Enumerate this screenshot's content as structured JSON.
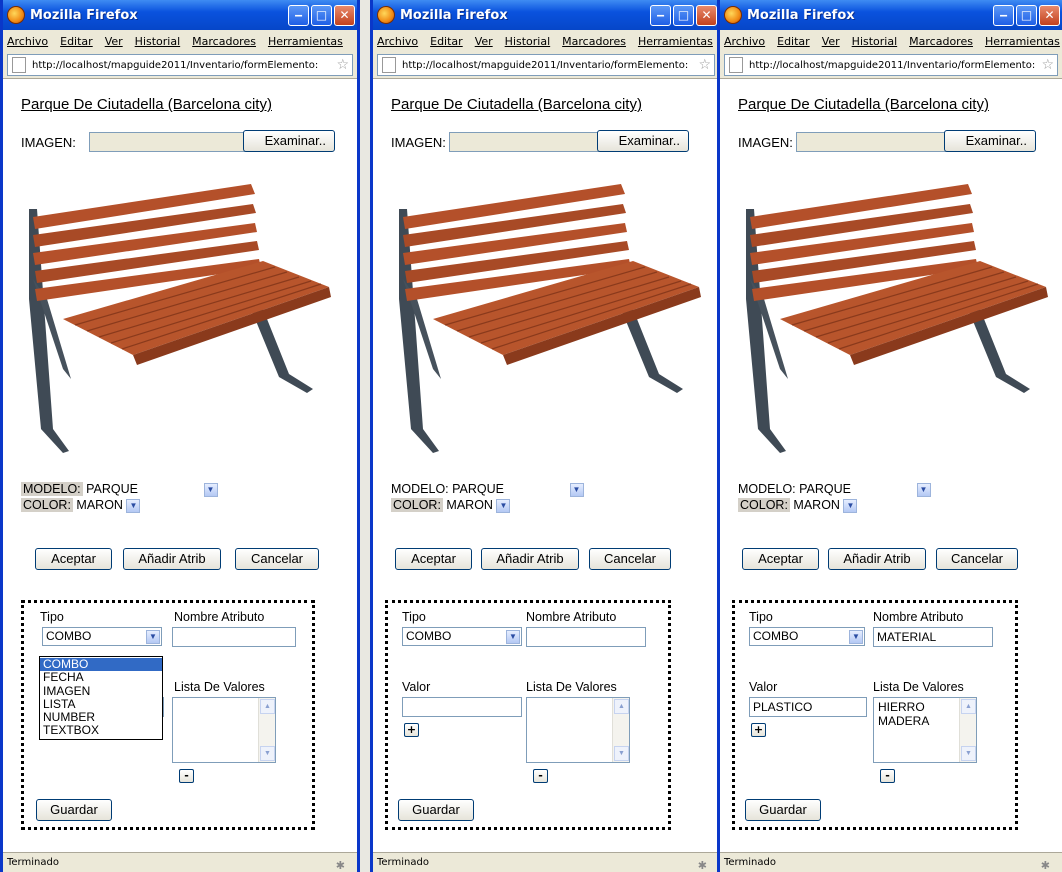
{
  "browser": {
    "title": "Mozilla Firefox",
    "menus": [
      "Archivo",
      "Editar",
      "Ver",
      "Historial",
      "Marcadores",
      "Herramientas"
    ],
    "url": "http://localhost/mapguide2011/Inventario/formElemento:",
    "status": "Terminado"
  },
  "form": {
    "title": "Parque De Ciutadella (Barcelona  city)",
    "image_label": "IMAGEN:",
    "browse_button": "Examinar..",
    "modelo_label": "MODELO:",
    "modelo_value": "PARQUE",
    "color_label": "COLOR:",
    "color_value": "MARON",
    "accept_button": "Aceptar",
    "add_attr_button": "Añadir Atrib",
    "cancel_button": "Cancelar",
    "tipo_label": "Tipo",
    "nombre_label": "Nombre Atributo",
    "valor_label": "Valor",
    "lista_label": "Lista De Valores",
    "plus_button": "+",
    "minus_button": "-",
    "save_button": "Guardar"
  },
  "windows": [
    {
      "tipo_value": "COMBO",
      "nombre_value": "",
      "valor_value": "",
      "lista_values": [],
      "tipo_options": [
        "COMBO",
        "FECHA",
        "IMAGEN",
        "LISTA",
        "NUMBER",
        "TEXTBOX"
      ],
      "tipo_options_highlighted": "COMBO"
    },
    {
      "tipo_value": "COMBO",
      "nombre_value": "",
      "valor_value": "",
      "lista_values": []
    },
    {
      "tipo_value": "COMBO",
      "nombre_value": "MATERIAL",
      "valor_value": "PLASTICO",
      "lista_values": [
        "HIERRO",
        "MADERA"
      ]
    }
  ],
  "colors": {
    "titlebar": "#0a52de",
    "chrome": "#ece9d8",
    "selection": "#316ac5",
    "bench_wood": "#b4502a",
    "bench_frame": "#3f4a55"
  }
}
